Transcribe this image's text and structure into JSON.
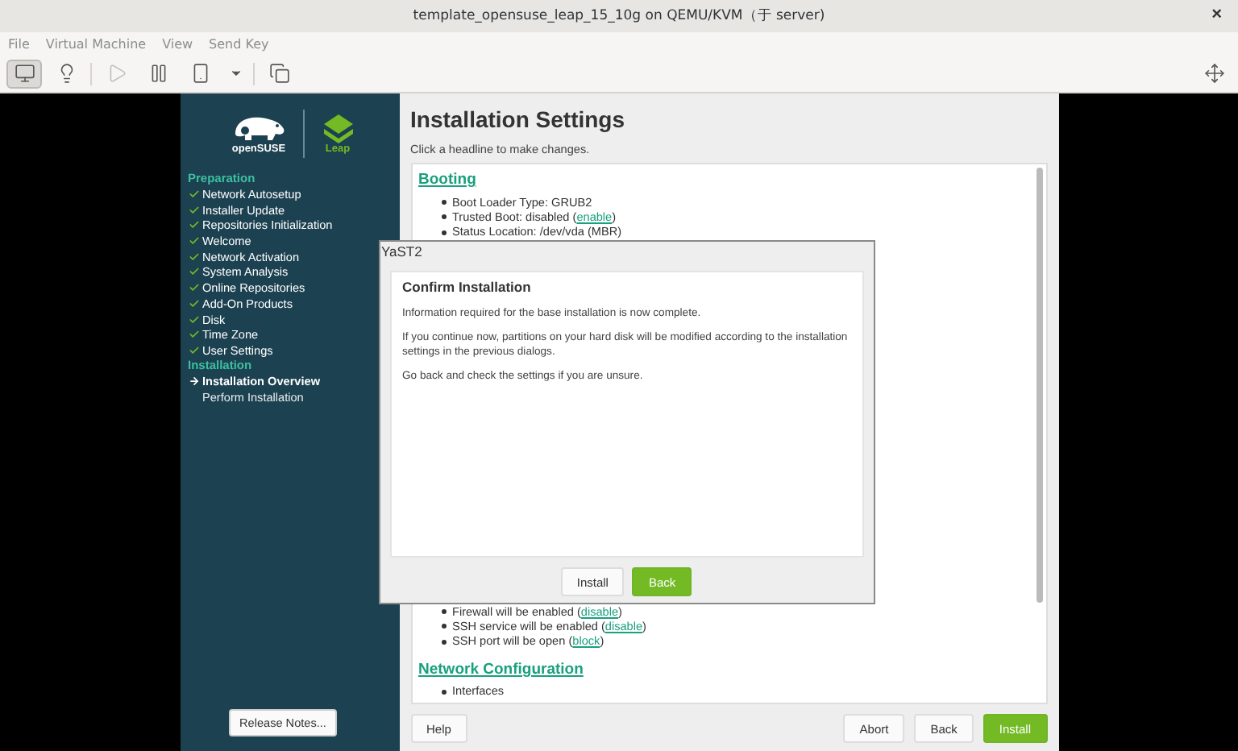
{
  "window": {
    "title": "template_opensuse_leap_15_10g on QEMU/KVM（于 server)",
    "close": "×"
  },
  "menu": [
    "File",
    "Virtual Machine",
    "View",
    "Send Key"
  ],
  "toolbar": [
    {
      "selected": true,
      "disabled": false
    },
    {
      "selected": false,
      "disabled": false
    },
    {
      "selected": false,
      "disabled": true
    },
    {
      "selected": false,
      "disabled": false
    },
    {
      "selected": false,
      "disabled": false
    },
    {
      "selected": false,
      "disabled": false
    },
    {
      "selected": false,
      "disabled": false
    },
    {
      "selected": false,
      "disabled": false
    }
  ],
  "sidebar": {
    "brand": "openSUSE",
    "product": "Leap",
    "sections": [
      {
        "title": "Preparation",
        "items": [
          {
            "label": "Network Autosetup",
            "done": true,
            "current": false
          },
          {
            "label": "Installer Update",
            "done": true,
            "current": false
          },
          {
            "label": "Repositories Initialization",
            "done": true,
            "current": false
          },
          {
            "label": "Welcome",
            "done": true,
            "current": false
          },
          {
            "label": "Network Activation",
            "done": true,
            "current": false
          },
          {
            "label": "System Analysis",
            "done": true,
            "current": false
          },
          {
            "label": "Online Repositories",
            "done": true,
            "current": false
          },
          {
            "label": "Add-On Products",
            "done": true,
            "current": false
          },
          {
            "label": "Disk",
            "done": true,
            "current": false
          },
          {
            "label": "Time Zone",
            "done": true,
            "current": false
          },
          {
            "label": "User Settings",
            "done": true,
            "current": false
          }
        ]
      },
      {
        "title": "Installation",
        "items": [
          {
            "label": "Installation Overview",
            "done": false,
            "current": true
          },
          {
            "label": "Perform Installation",
            "done": false,
            "current": false
          }
        ]
      }
    ],
    "release_notes": "Release Notes..."
  },
  "main": {
    "title": "Installation Settings",
    "hint": "Click a headline to make changes.",
    "blocks": [
      {
        "kind": "heading",
        "text": "Booting"
      },
      {
        "kind": "list",
        "items": [
          {
            "before": "Boot Loader Type: GRUB2"
          },
          {
            "before": "Trusted Boot: disabled (",
            "link": "enable",
            "after": ")"
          },
          {
            "before": "Status Location: /dev/vda (MBR)"
          }
        ]
      },
      {
        "kind": "gap"
      },
      {
        "kind": "list",
        "items": [
          {
            "before": "Firewall will be enabled (",
            "link": "disable",
            "after": ")"
          },
          {
            "before": "SSH service will be enabled (",
            "link": "disable",
            "after": ")"
          },
          {
            "before": "SSH port will be open (",
            "link": "block",
            "after": ")"
          }
        ]
      },
      {
        "kind": "heading",
        "text": "Network Configuration"
      },
      {
        "kind": "list",
        "items": [
          {
            "before": "Interfaces"
          }
        ]
      }
    ],
    "buttons": [
      {
        "label": "Help",
        "primary": false
      },
      {
        "label": "Abort",
        "primary": false
      },
      {
        "label": "Back",
        "primary": false
      },
      {
        "label": "Install",
        "primary": true
      }
    ]
  },
  "dialog": {
    "title": "YaST2",
    "heading": "Confirm Installation",
    "paragraphs": [
      "Information required for the base installation is now complete.",
      "If you continue now, partitions on your hard disk will be modified according to the installation settings in the previous dialogs.",
      "Go back and check the settings if you are unsure."
    ],
    "buttons": [
      {
        "label": "Install",
        "primary": false
      },
      {
        "label": "Back",
        "primary": true
      }
    ]
  }
}
